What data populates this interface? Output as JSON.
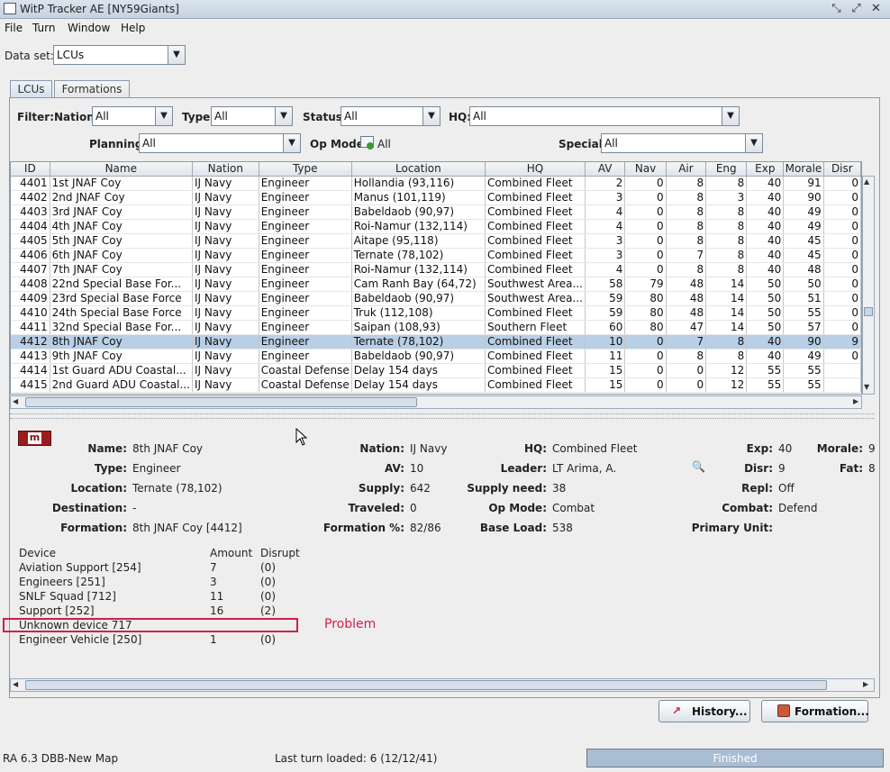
{
  "window": {
    "title": "WitP Tracker AE [NY59Giants]"
  },
  "menu": [
    "File",
    "Turn",
    "Window",
    "Help"
  ],
  "dataset": {
    "label": "Data set:",
    "value": "LCUs"
  },
  "tabs": [
    "LCUs",
    "Formations"
  ],
  "filters": {
    "filter_label": "Filter:",
    "nation": {
      "label": "Nation:",
      "value": "All"
    },
    "type": {
      "label": "Type:",
      "value": "All"
    },
    "status": {
      "label": "Status:",
      "value": "All"
    },
    "hq": {
      "label": "HQ:",
      "value": "All"
    },
    "planning": {
      "label": "Planning:",
      "value": "All"
    },
    "opmode": {
      "label": "Op Mode:",
      "value": "All"
    },
    "special": {
      "label": "Special:",
      "value": "All"
    }
  },
  "table": {
    "columns": [
      "ID",
      "Name",
      "Nation",
      "Type",
      "Location",
      "HQ",
      "AV",
      "Nav",
      "Air",
      "Eng",
      "Exp",
      "Morale",
      "Disr"
    ],
    "rows": [
      [
        "4401",
        "1st JNAF Coy",
        "IJ Navy",
        "Engineer",
        "Hollandia (93,116)",
        "Combined Fleet",
        "2",
        "0",
        "8",
        "8",
        "40",
        "91",
        "0"
      ],
      [
        "4402",
        "2nd JNAF Coy",
        "IJ Navy",
        "Engineer",
        "Manus (101,119)",
        "Combined Fleet",
        "3",
        "0",
        "8",
        "3",
        "40",
        "90",
        "0"
      ],
      [
        "4403",
        "3rd JNAF Coy",
        "IJ Navy",
        "Engineer",
        "Babeldaob (90,97)",
        "Combined Fleet",
        "4",
        "0",
        "8",
        "8",
        "40",
        "49",
        "0"
      ],
      [
        "4404",
        "4th JNAF Coy",
        "IJ Navy",
        "Engineer",
        "Roi-Namur (132,114)",
        "Combined Fleet",
        "4",
        "0",
        "8",
        "8",
        "40",
        "49",
        "0"
      ],
      [
        "4405",
        "5th JNAF Coy",
        "IJ Navy",
        "Engineer",
        "Aitape (95,118)",
        "Combined Fleet",
        "3",
        "0",
        "8",
        "8",
        "40",
        "45",
        "0"
      ],
      [
        "4406",
        "6th JNAF Coy",
        "IJ Navy",
        "Engineer",
        "Ternate (78,102)",
        "Combined Fleet",
        "3",
        "0",
        "7",
        "8",
        "40",
        "45",
        "0"
      ],
      [
        "4407",
        "7th JNAF Coy",
        "IJ Navy",
        "Engineer",
        "Roi-Namur (132,114)",
        "Combined Fleet",
        "4",
        "0",
        "8",
        "8",
        "40",
        "48",
        "0"
      ],
      [
        "4408",
        "22nd Special Base For...",
        "IJ Navy",
        "Engineer",
        "Cam Ranh Bay (64,72)",
        "Southwest Area...",
        "58",
        "79",
        "48",
        "14",
        "50",
        "50",
        "0"
      ],
      [
        "4409",
        "23rd Special Base Force",
        "IJ Navy",
        "Engineer",
        "Babeldaob (90,97)",
        "Southwest Area...",
        "59",
        "80",
        "48",
        "14",
        "50",
        "51",
        "0"
      ],
      [
        "4410",
        "24th Special Base Force",
        "IJ Navy",
        "Engineer",
        "Truk (112,108)",
        "Combined Fleet",
        "59",
        "80",
        "48",
        "14",
        "50",
        "55",
        "0"
      ],
      [
        "4411",
        "32nd Special Base For...",
        "IJ Navy",
        "Engineer",
        "Saipan (108,93)",
        "Southern Fleet",
        "60",
        "80",
        "47",
        "14",
        "50",
        "57",
        "0"
      ],
      [
        "4412",
        "8th JNAF Coy",
        "IJ Navy",
        "Engineer",
        "Ternate (78,102)",
        "Combined Fleet",
        "10",
        "0",
        "7",
        "8",
        "40",
        "90",
        "9"
      ],
      [
        "4413",
        "9th JNAF Coy",
        "IJ Navy",
        "Engineer",
        "Babeldaob (90,97)",
        "Combined Fleet",
        "11",
        "0",
        "8",
        "8",
        "40",
        "49",
        "0"
      ],
      [
        "4414",
        "1st Guard ADU Coastal...",
        "IJ Navy",
        "Coastal Defense",
        "Delay 154 days",
        "Combined Fleet",
        "15",
        "0",
        "0",
        "12",
        "55",
        "55",
        ""
      ],
      [
        "4415",
        "2nd Guard ADU Coastal...",
        "IJ Navy",
        "Coastal Defense",
        "Delay 154 days",
        "Combined Fleet",
        "15",
        "0",
        "0",
        "12",
        "55",
        "55",
        ""
      ]
    ],
    "selected_row": 11
  },
  "details": {
    "icon_letter": "m",
    "col1": [
      [
        "Name:",
        "8th JNAF Coy"
      ],
      [
        "Type:",
        "Engineer"
      ],
      [
        "Location:",
        "Ternate (78,102)"
      ],
      [
        "Destination:",
        "-"
      ],
      [
        "Formation:",
        "8th JNAF Coy [4412]"
      ]
    ],
    "col2": [
      [
        "Nation:",
        "IJ Navy"
      ],
      [
        "AV:",
        "10"
      ],
      [
        "Supply:",
        "642"
      ],
      [
        "Traveled:",
        "0"
      ],
      [
        "Formation %:",
        "82/86"
      ]
    ],
    "col3": [
      [
        "HQ:",
        "Combined Fleet"
      ],
      [
        "Leader:",
        "LT Arima, A."
      ],
      [
        "Supply need:",
        "38"
      ],
      [
        "Op Mode:",
        "Combat"
      ],
      [
        "Base Load:",
        "538"
      ]
    ],
    "col4": [
      [
        "Exp:",
        "40"
      ],
      [
        "Disr:",
        "9"
      ],
      [
        "Repl:",
        "Off"
      ],
      [
        "Combat:",
        "Defend"
      ],
      [
        "Primary Unit:",
        ""
      ]
    ],
    "col5": [
      [
        "Morale:",
        "9"
      ],
      [
        "Fat:",
        "8"
      ]
    ]
  },
  "devices": {
    "headers": [
      "Device",
      "Amount",
      "Disrupt"
    ],
    "rows": [
      [
        "Aviation Support [254]",
        "7",
        "(0)"
      ],
      [
        "Engineers [251]",
        "3",
        "(0)"
      ],
      [
        "SNLF Squad [712]",
        "11",
        "(0)"
      ],
      [
        "Support [252]",
        "16",
        "(2)"
      ],
      [
        "Unknown device 717",
        "",
        ""
      ],
      [
        "Engineer Vehicle [250]",
        "1",
        "(0)"
      ]
    ],
    "problem_label": "Problem"
  },
  "buttons": {
    "history": "History...",
    "formation": "Formation..."
  },
  "status": {
    "left": "RA 6.3 DBB-New Map",
    "turn": "Last turn loaded: 6 (12/12/41)",
    "progress_text": "Finished",
    "progress": 1.0
  },
  "colors": {
    "accent_red": "#d0204a",
    "selected_row": "#b8cfe5",
    "progress": "#a9bdd3"
  }
}
